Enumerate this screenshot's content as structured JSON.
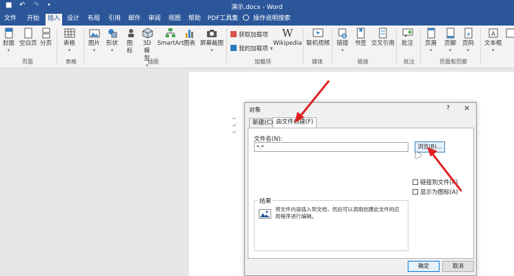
{
  "window": {
    "title": "演示.docx  -  Word"
  },
  "tabs": [
    "文件",
    "开始",
    "插入",
    "设计",
    "布局",
    "引用",
    "邮件",
    "审阅",
    "视图",
    "帮助",
    "PDF工具集"
  ],
  "tell_me": "操作说明搜索",
  "ribbon": {
    "page_group": {
      "name": "页面",
      "buttons": [
        "封面",
        "空白页",
        "分页"
      ]
    },
    "table_group": {
      "name": "表格",
      "buttons": [
        "表格"
      ]
    },
    "illustration_group": {
      "name": "插图",
      "buttons": [
        "图片",
        "形状",
        "图标",
        "3D 模型",
        "SmartArt",
        "图表",
        "屏幕截图"
      ]
    },
    "addins_group": {
      "name": "加载项",
      "get_addins": "获取加载项",
      "my_addins": "我的加载项",
      "wikipedia": "Wikipedia"
    },
    "media_group": {
      "name": "媒体",
      "buttons": [
        "联机视频"
      ]
    },
    "links_group": {
      "name": "链接",
      "buttons": [
        "链接",
        "书签",
        "交叉引用"
      ]
    },
    "comments_group": {
      "name": "批注",
      "buttons": [
        "批注"
      ]
    },
    "headerfooter_group": {
      "name": "页眉和页脚",
      "buttons": [
        "页眉",
        "页脚",
        "页码"
      ]
    },
    "text_group": {
      "buttons": [
        "文本框"
      ]
    }
  },
  "dialog": {
    "title": "对象",
    "help": "?",
    "close": "×",
    "tabs": [
      "新建(C)",
      "由文件创建(F)"
    ],
    "filename_label": "文件名(N):",
    "filename_value": "*.*",
    "browse_label": "浏览(B)...",
    "link_to_file": "链接到文件(K)",
    "display_as_icon": "显示为图标(A)",
    "result_label": "结果",
    "result_text": "将文件内容插入到文档，然后可以调用创建此文件的应用程序进行编辑。",
    "ok_label": "确定",
    "cancel_label": "取消"
  },
  "colors": {
    "word_blue": "#2b579a",
    "arrow_red": "#e02020"
  }
}
